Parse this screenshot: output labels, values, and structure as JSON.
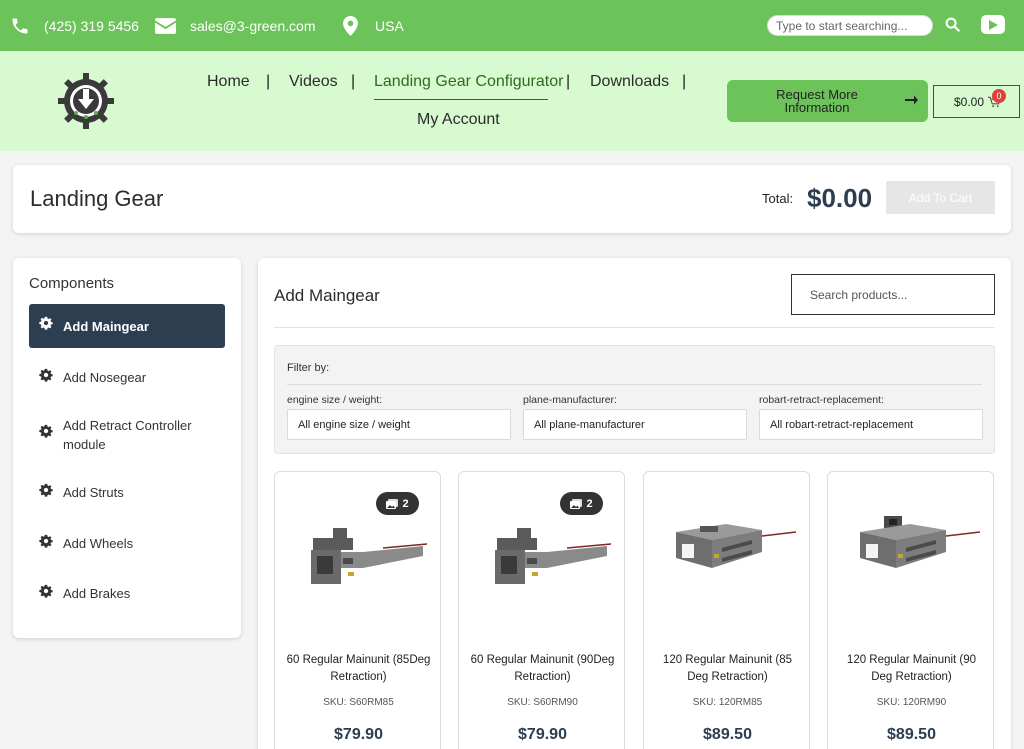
{
  "topbar": {
    "phone": "(425) 319 5456",
    "email": "sales@3-green.com",
    "location": "USA",
    "search_placeholder": "Type to start searching..."
  },
  "nav": {
    "home": "Home",
    "videos": "Videos",
    "configurator": "Landing Gear Configurator",
    "downloads": "Downloads",
    "account": "My Account",
    "separator": "|"
  },
  "header": {
    "request_label": "Request More Information",
    "cart_total": "$0.00",
    "cart_count": "0"
  },
  "builder": {
    "title": "Landing Gear",
    "total_label": "Total:",
    "total_value": "$0.00",
    "add_to_cart": "Add To Cart"
  },
  "sidebar": {
    "title": "Components",
    "items": [
      {
        "label": "Add Maingear"
      },
      {
        "label": "Add Nosegear"
      },
      {
        "label": "Add Retract Controller module"
      },
      {
        "label": "Add Struts"
      },
      {
        "label": "Add Wheels"
      },
      {
        "label": "Add Brakes"
      }
    ]
  },
  "main": {
    "title": "Add Maingear",
    "search_placeholder": "Search products...",
    "filter_title": "Filter by:",
    "filters": [
      {
        "label": "engine size / weight:",
        "value": "All engine size / weight"
      },
      {
        "label": "plane-manufacturer:",
        "value": "All plane-manufacturer"
      },
      {
        "label": "robart-retract-replacement:",
        "value": "All robart-retract-replacement"
      }
    ]
  },
  "products": [
    {
      "name": "60 Regular Mainunit (85Deg Retraction)",
      "sku": "SKU: S60RM85",
      "price": "$79.90",
      "images": "2"
    },
    {
      "name": "60 Regular Mainunit (90Deg Retraction)",
      "sku": "SKU: S60RM90",
      "price": "$79.90",
      "images": "2"
    },
    {
      "name": "120 Regular Mainunit (85 Deg Retraction)",
      "sku": "SKU: 120RM85",
      "price": "$89.50"
    },
    {
      "name": "120 Regular Mainunit (90 Deg Retraction)",
      "sku": "SKU: 120RM90",
      "price": "$89.50"
    }
  ],
  "colors": {
    "topbar": "#6cc35a",
    "header_bg": "#d7fad0",
    "navy": "#2d3e50"
  }
}
